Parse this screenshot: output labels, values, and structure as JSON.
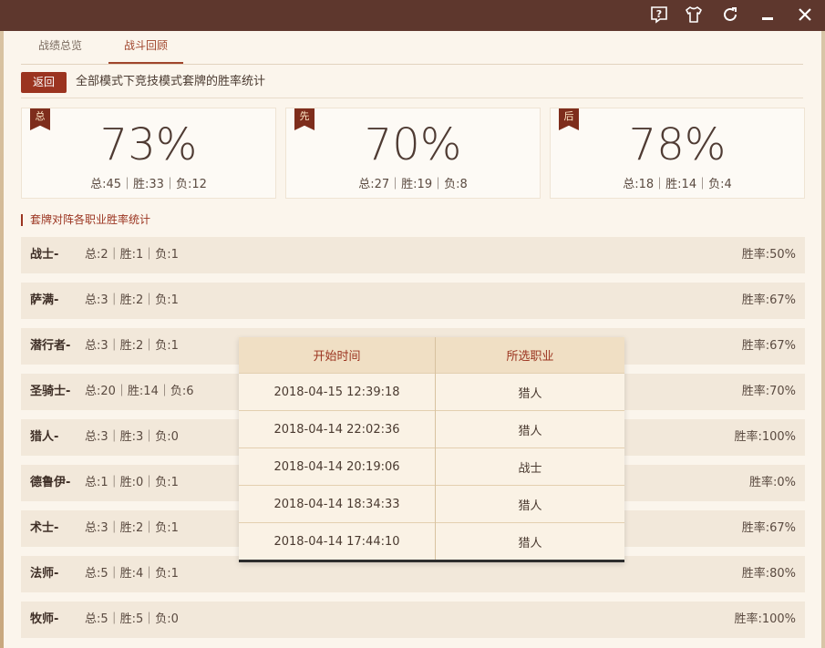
{
  "tabs": [
    {
      "label": "战绩总览",
      "active": false
    },
    {
      "label": "战斗回顾",
      "active": true
    }
  ],
  "back_label": "返回",
  "section_title": "全部模式下竞技模式套牌的胜率统计",
  "summary_cards": [
    {
      "ribbon": "总",
      "percent": "73%",
      "stats": "总:45｜胜:33｜负:12"
    },
    {
      "ribbon": "先",
      "percent": "70%",
      "stats": "总:27｜胜:19｜负:8"
    },
    {
      "ribbon": "后",
      "percent": "78%",
      "stats": "总:18｜胜:14｜负:4"
    }
  ],
  "sub_title": "套牌对阵各职业胜率统计",
  "class_rows": [
    {
      "name": "战士-",
      "stats": "总:2｜胜:1｜负:1",
      "rate": "胜率:50%"
    },
    {
      "name": "萨满-",
      "stats": "总:3｜胜:2｜负:1",
      "rate": "胜率:67%"
    },
    {
      "name": "潜行者-",
      "stats": "总:3｜胜:2｜负:1",
      "rate": "胜率:67%"
    },
    {
      "name": "圣骑士-",
      "stats": "总:20｜胜:14｜负:6",
      "rate": "胜率:70%"
    },
    {
      "name": "猎人-",
      "stats": "总:3｜胜:3｜负:0",
      "rate": "胜率:100%"
    },
    {
      "name": "德鲁伊-",
      "stats": "总:1｜胜:0｜负:1",
      "rate": "胜率:0%"
    },
    {
      "name": "术士-",
      "stats": "总:3｜胜:2｜负:1",
      "rate": "胜率:67%"
    },
    {
      "name": "法师-",
      "stats": "总:5｜胜:4｜负:1",
      "rate": "胜率:80%"
    },
    {
      "name": "牧师-",
      "stats": "总:5｜胜:5｜负:0",
      "rate": "胜率:100%"
    }
  ],
  "popup": {
    "headers": [
      "开始时间",
      "所选职业"
    ],
    "rows": [
      [
        "2018-04-15 12:39:18",
        "猎人"
      ],
      [
        "2018-04-14 22:02:36",
        "猎人"
      ],
      [
        "2018-04-14 20:19:06",
        "战士"
      ],
      [
        "2018-04-14 18:34:33",
        "猎人"
      ],
      [
        "2018-04-14 17:44:10",
        "猎人"
      ]
    ]
  },
  "titlebar_icons": [
    "help-icon",
    "skin-icon",
    "refresh-icon",
    "minimize-icon",
    "close-icon"
  ],
  "colors": {
    "titlebar": "#5e372d",
    "accent": "#9b3420",
    "panel": "#fbf5ec",
    "row": "#f2e8da"
  }
}
